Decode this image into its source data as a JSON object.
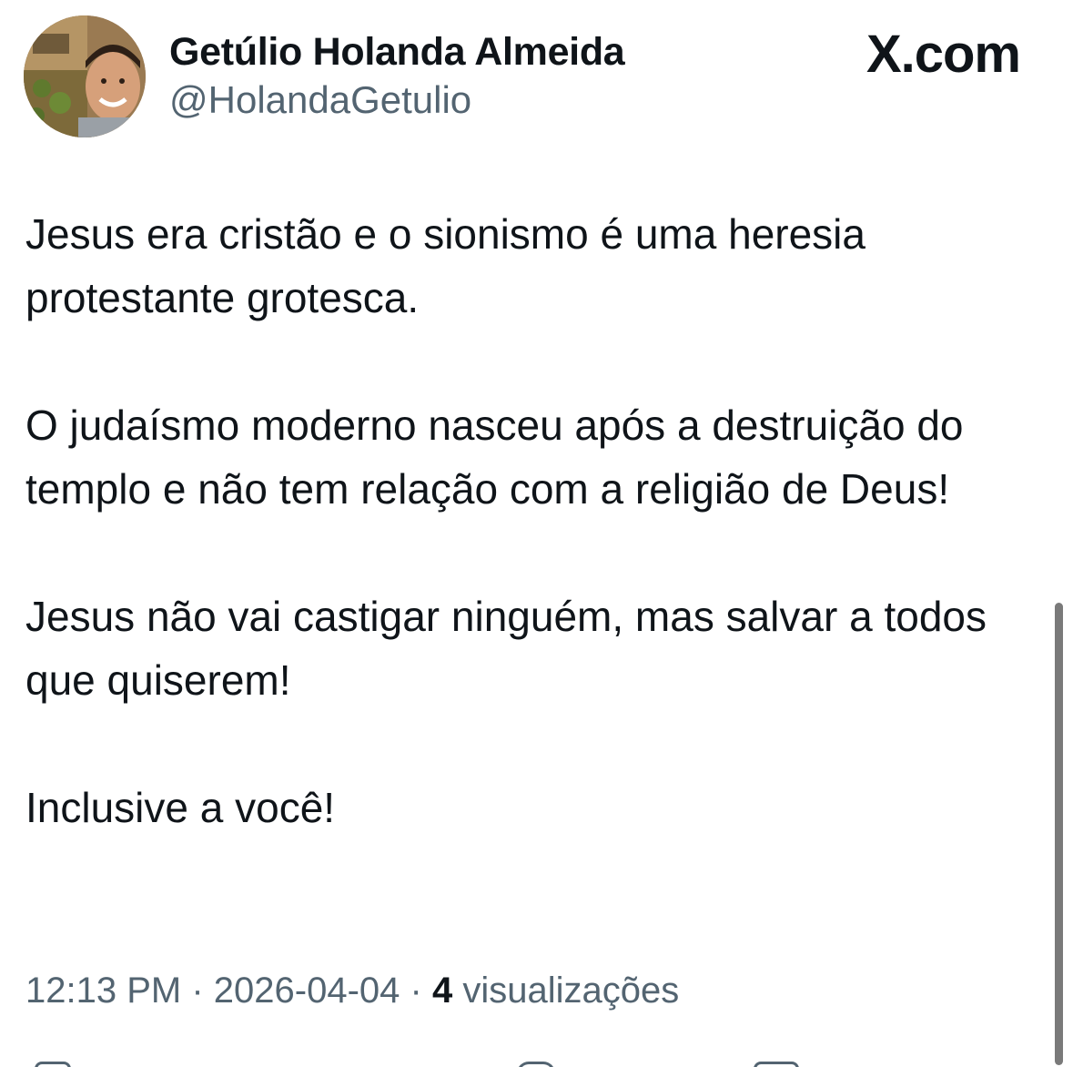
{
  "author": {
    "name": "Getúlio Holanda Almeida",
    "handle": "@HolandaGetulio",
    "avatar_icon": "profile-photo-avatar"
  },
  "brand": {
    "label": "X.com"
  },
  "tweet": {
    "paragraphs": [
      "Jesus era cristão e o sionismo é uma heresia protestante grotesca.",
      "O judaísmo moderno nasceu após a destruição do templo e não tem relação com a religião de Deus!",
      "Jesus não vai castigar ninguém, mas salvar a todos que quiserem!",
      "Inclusive a você!"
    ]
  },
  "meta": {
    "time": "12:13 PM",
    "date": "2026-04-04",
    "separator": "·",
    "views_count": "4",
    "views_label": "visualizações"
  },
  "colors": {
    "text_primary": "#0f1419",
    "text_secondary": "#536471",
    "background": "#ffffff"
  },
  "actions": [
    {
      "name": "reply-icon"
    },
    {
      "name": "repost-icon"
    },
    {
      "name": "like-icon"
    },
    {
      "name": "bookmark-icon"
    }
  ]
}
